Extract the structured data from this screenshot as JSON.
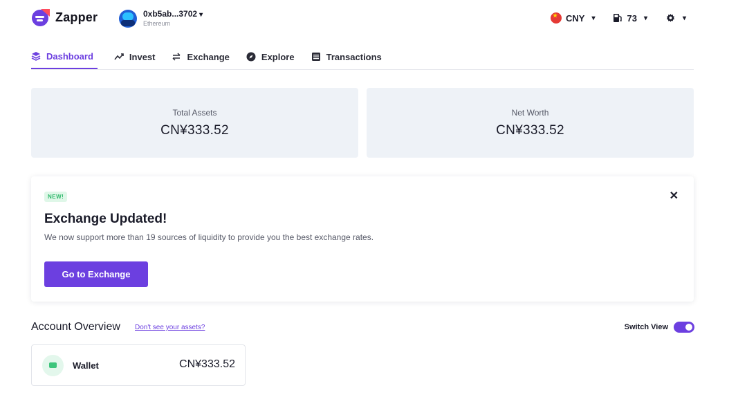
{
  "app": {
    "name": "Zapper",
    "brand_color": "#6c3fe0"
  },
  "account": {
    "address": "0xb5ab...3702",
    "network": "Ethereum"
  },
  "header": {
    "currency": "CNY",
    "gas": "73"
  },
  "nav": {
    "tabs": [
      {
        "label": "Dashboard",
        "icon": "layers-icon",
        "active": true
      },
      {
        "label": "Invest",
        "icon": "trend-up-icon",
        "active": false
      },
      {
        "label": "Exchange",
        "icon": "arrows-swap-icon",
        "active": false
      },
      {
        "label": "Explore",
        "icon": "compass-icon",
        "active": false
      },
      {
        "label": "Transactions",
        "icon": "list-icon",
        "active": false
      }
    ]
  },
  "summary": {
    "total_assets": {
      "label": "Total Assets",
      "value": "CN¥333.52"
    },
    "net_worth": {
      "label": "Net Worth",
      "value": "CN¥333.52"
    }
  },
  "banner": {
    "badge": "NEW!",
    "title": "Exchange Updated!",
    "text": "We now support more than 19 sources of liquidity to provide you the best exchange rates.",
    "button": "Go to Exchange",
    "close": "✕"
  },
  "overview": {
    "title": "Account Overview",
    "link": "Don't see your assets?",
    "switch_label": "Switch View",
    "switch_on": true,
    "wallet": {
      "label": "Wallet",
      "value": "CN¥333.52"
    }
  }
}
